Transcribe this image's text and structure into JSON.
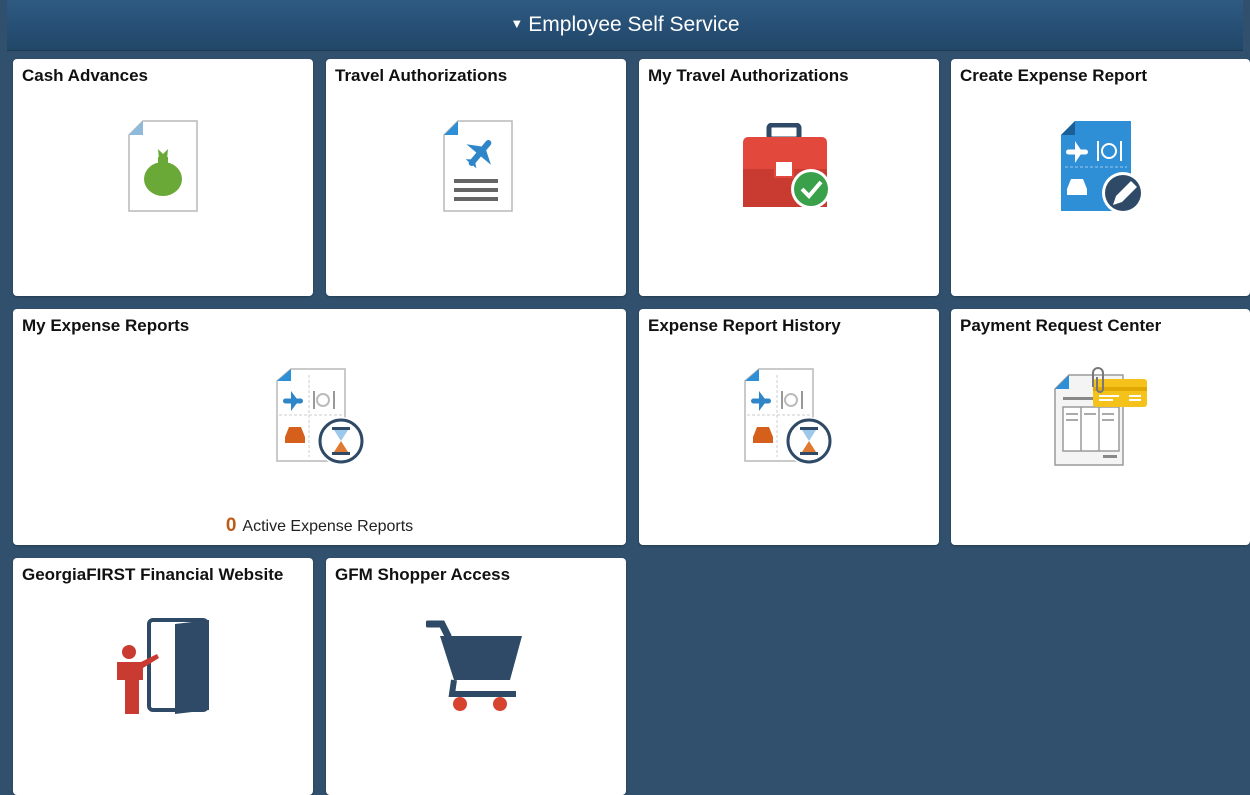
{
  "header": {
    "title": "Employee Self Service",
    "caret": "▼"
  },
  "tiles": {
    "cash_advances": {
      "title": "Cash Advances"
    },
    "travel_authorizations": {
      "title": "Travel Authorizations"
    },
    "my_travel_authorizations": {
      "title": "My Travel Authorizations"
    },
    "create_expense_report": {
      "title": "Create Expense Report"
    },
    "my_expense_reports": {
      "title": "My Expense Reports",
      "count": "0",
      "count_label": "Active Expense Reports"
    },
    "expense_report_history": {
      "title": "Expense Report History"
    },
    "payment_request_center": {
      "title": "Payment Request Center"
    },
    "georgiafirst_financial_website": {
      "title": "GeorgiaFIRST Financial Website"
    },
    "gfm_shopper_access": {
      "title": "GFM Shopper Access"
    }
  },
  "colors": {
    "background": "#31506d",
    "header": "#264e74",
    "count_accent": "#c05b17"
  }
}
